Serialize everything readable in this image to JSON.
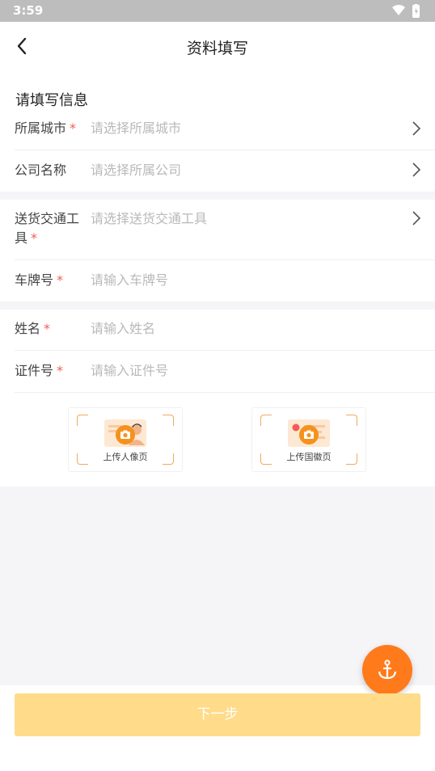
{
  "status_bar": {
    "time": "3:59"
  },
  "header": {
    "title": "资料填写"
  },
  "section": {
    "title": "请填写信息"
  },
  "form": {
    "city": {
      "label": "所属城市",
      "required": "*",
      "placeholder": "请选择所属城市"
    },
    "company": {
      "label": "公司名称",
      "placeholder": "请选择所属公司"
    },
    "vehicle": {
      "label_line1": "送货交通工",
      "label_line2": "具",
      "required": "*",
      "placeholder": "请选择送货交通工具"
    },
    "plate": {
      "label": "车牌号",
      "required": "*",
      "placeholder": "请输入车牌号"
    },
    "name": {
      "label": "姓名",
      "required": "*",
      "placeholder": "请输入姓名"
    },
    "id_number": {
      "label": "证件号",
      "required": "*",
      "placeholder": "请输入证件号"
    }
  },
  "uploads": {
    "portrait_label": "上传人像页",
    "emblem_label": "上传国徽页"
  },
  "footer": {
    "next_label": "下一步"
  },
  "colors": {
    "accent": "#ff7a1a",
    "required": "#f25c54",
    "button_disabled": "#ffdb8a",
    "placeholder": "#b9b9b9"
  },
  "icons": [
    "back-arrow-icon",
    "chevron-right-icon",
    "camera-icon",
    "anchor-icon",
    "wifi-icon",
    "battery-icon"
  ]
}
